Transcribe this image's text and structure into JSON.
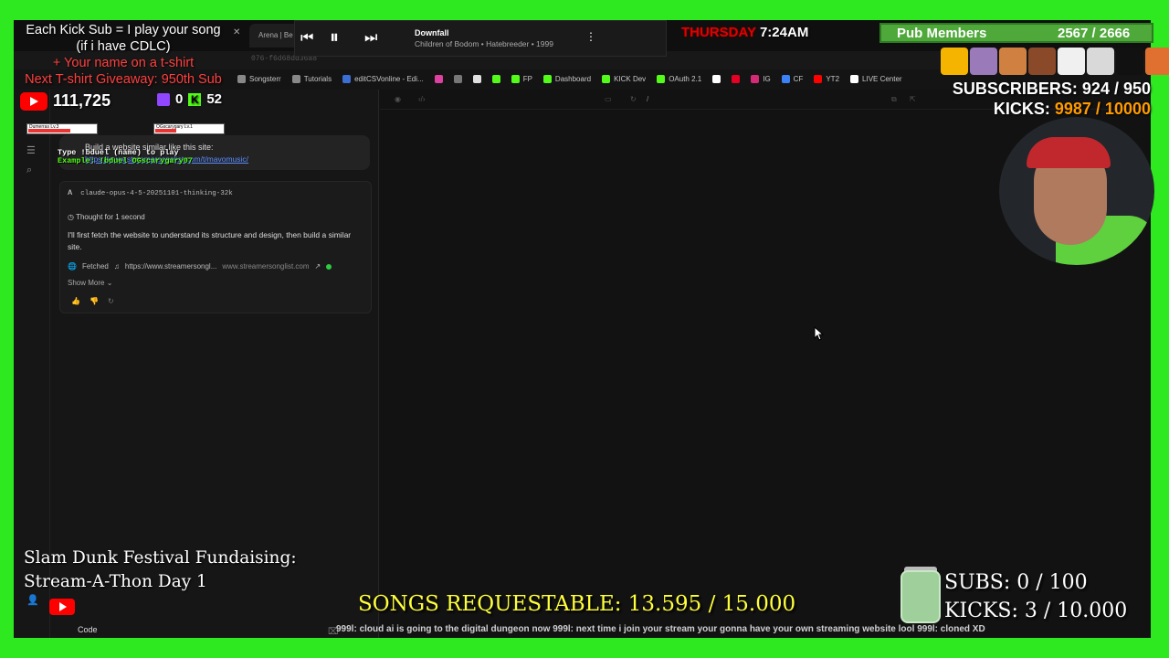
{
  "browser": {
    "tab_active": "Arena | Be",
    "url_fragment": "076-f6d68dd36a8",
    "bookmarks": [
      {
        "label": "Songsterr",
        "icon": "page-icon",
        "color": "#888888"
      },
      {
        "label": "Tutorials",
        "icon": "folder-icon",
        "color": "#888888"
      },
      {
        "label": "editCSVonline - Edi...",
        "icon": "csv-icon",
        "color": "#3b6fd6"
      },
      {
        "label": "",
        "icon": "color-icon",
        "color": "#e040a0"
      },
      {
        "label": "",
        "icon": "shield-icon",
        "color": "#777777"
      },
      {
        "label": "",
        "icon": "chrome-icon",
        "color": "#e0e0e0"
      },
      {
        "label": "",
        "icon": "kick-icon",
        "color": "#53fc18"
      },
      {
        "label": "FP",
        "icon": "kick-icon",
        "color": "#53fc18"
      },
      {
        "label": "Dashboard",
        "icon": "kick-icon",
        "color": "#53fc18"
      },
      {
        "label": "KICK Dev",
        "icon": "kick-icon",
        "color": "#53fc18"
      },
      {
        "label": "OAuth 2.1",
        "icon": "kick-icon",
        "color": "#53fc18"
      },
      {
        "label": "",
        "icon": "tiktok-icon",
        "color": "#ffffff"
      },
      {
        "label": "",
        "icon": "pinterest-icon",
        "color": "#e60023"
      },
      {
        "label": "IG",
        "icon": "instagram-icon",
        "color": "#d62976"
      },
      {
        "label": "CF",
        "icon": "cf-icon",
        "color": "#3b82f6"
      },
      {
        "label": "YT2",
        "icon": "youtube-icon",
        "color": "#ff0000"
      },
      {
        "label": "LIVE Center",
        "icon": "tiktok-icon",
        "color": "#ffffff"
      }
    ],
    "preview_path": "/"
  },
  "chat": {
    "prompt_title": "Build a website similar like this site:",
    "prompt_link": "https://www.streamersonglist.com/t/mavomusic/",
    "model": "claude-opus-4-5-20251101-thinking-32k",
    "thought": "Thought for 1 second",
    "answer": "I'll first fetch the website to understand its structure and design, then build a similar site.",
    "fetched_label": "Fetched",
    "fetched_url": "https://www.streamersongl...",
    "fetched_domain": "www.streamersonglist.com",
    "show_more": "Show More",
    "code_button": "Code",
    "model_tag": "claude-o"
  },
  "overlay": {
    "kick_sub_line1": "Each Kick Sub = I play your song",
    "kick_sub_line2": "(if i have CDLC)",
    "kick_sub_line3": "+ Your name on a t-shirt",
    "kick_sub_line4": "Next T-shirt Giveaway: 950th Sub",
    "yt_count": "111,725",
    "twitch_count": "0",
    "kick_count": "52",
    "duel_line1": "Type !bduel (name) to play",
    "duel_line2": "Example: !bduel OGscarygary07",
    "duel_player1": "Dumerras Lv.3",
    "duel_player2": "OGscarygary Lv.1",
    "song_title": "Downfall",
    "song_artist": "Children of Bodom • Hatebreeder • 1999",
    "day": "THURSDAY",
    "time": "7:24AM",
    "pub_label": "Pub Members",
    "pub_count": "2567 / 2666",
    "subscribers_label": "SUBSCRIBERS:",
    "subscribers_value": "924 / 950",
    "kicks_label": "KICKS:",
    "kicks_value": "9987 / 10000",
    "fundraiser_line1": "Slam Dunk Festival Fundaising:",
    "fundraiser_line2": "Stream-A-Thon Day 1",
    "songs_requestable": "SONGS REQUESTABLE: 13.595 / 15.000",
    "subs_goal": "SUBS:  0 / 100",
    "kicks_goal": "KICKS: 3 / 10.000",
    "ticker": "999l: cloud ai is going to the digital dungeon now   999l: next time i join your stream your gonna have your own streaming website lool   999l: cloned XD"
  },
  "colors": {
    "greenscreen": "#2ee820",
    "kick_green": "#53fc18",
    "twitch_purple": "#9146ff",
    "youtube_red": "#ff0000",
    "songs_yellow": "#ffff3a",
    "pub_green": "#4fa83a"
  }
}
